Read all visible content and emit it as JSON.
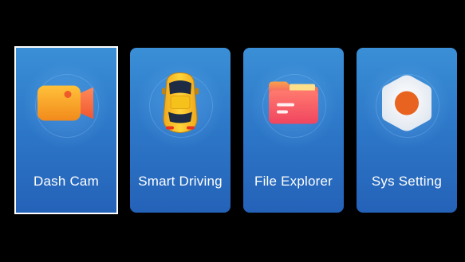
{
  "menu": {
    "items": [
      {
        "label": "Dash Cam",
        "icon": "video-camera-icon",
        "selected": true
      },
      {
        "label": "Smart Driving",
        "icon": "car-icon",
        "selected": false
      },
      {
        "label": "File Explorer",
        "icon": "folder-icon",
        "selected": false
      },
      {
        "label": "Sys Setting",
        "icon": "settings-icon",
        "selected": false
      }
    ]
  },
  "colors": {
    "background": "#000000",
    "tile": "#2e79c9",
    "selection_border": "#ffffff",
    "camera": "#f7a623",
    "car": "#f5c21b",
    "folder": "#f2566c",
    "settings_dot": "#e8631f"
  }
}
